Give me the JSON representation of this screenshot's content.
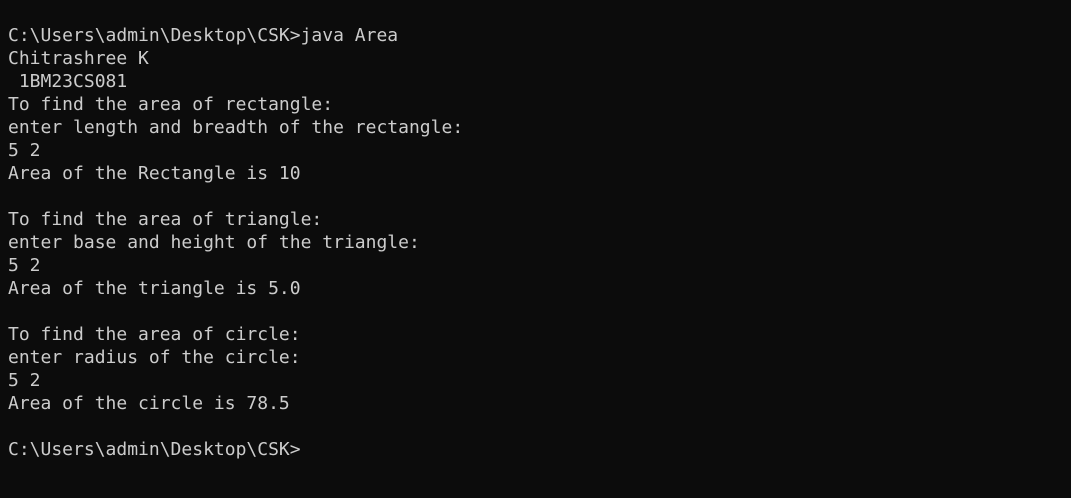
{
  "terminal": {
    "background": "#0c0c0c",
    "foreground": "#cccccc",
    "lines": [
      "C:\\Users\\admin\\Desktop\\CSK>java Area",
      "Chitrashree K",
      " 1BM23CS081",
      "To find the area of rectangle:",
      "enter length and breadth of the rectangle:",
      "5 2",
      "Area of the Rectangle is 10",
      "",
      "To find the area of triangle:",
      "enter base and height of the triangle:",
      "5 2",
      "Area of the triangle is 5.0",
      "",
      "To find the area of circle:",
      "enter radius of the circle:",
      "5 2",
      "Area of the circle is 78.5",
      "",
      "C:\\Users\\admin\\Desktop\\CSK>"
    ]
  }
}
